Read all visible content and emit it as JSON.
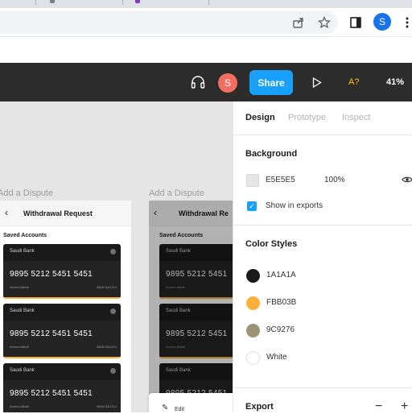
{
  "browser": {
    "profile_initial": "S"
  },
  "toolbar": {
    "avatar_initial": "S",
    "share_label": "Share",
    "accessibility_label": "A?",
    "zoom": "41%"
  },
  "canvas": {
    "frames": [
      {
        "label": "Add a Dispute",
        "title": "Withdrawal Request",
        "saved_label": "Saved Accounts",
        "cards": [
          {
            "bank": "Saudi Bank",
            "number": "9895  5212  5451  5451",
            "holder": "Ahmed Alttafi",
            "iban": "IBAN SA1214"
          },
          {
            "bank": "Saudi Bank",
            "number": "9895  5212  5451  5451",
            "holder": "Ahmed Alttafi",
            "iban": "IBAN SA1214"
          },
          {
            "bank": "Saudi Bank",
            "number": "9895  5212  5451  5451",
            "holder": "Ahmed Alttafi",
            "iban": "IBAN SA1214"
          }
        ]
      },
      {
        "label": "Add a Dispute",
        "title": "Withdrawal Re",
        "saved_label": "Saved Accounts",
        "cards": [
          {
            "bank": "Saudi Bank",
            "number": "9895  5212  5451",
            "holder": "Ahmed Alttafi",
            "iban": ""
          },
          {
            "bank": "Saudi Bank",
            "number": "9895  5212  5451",
            "holder": "Ahmed Alttafi",
            "iban": ""
          },
          {
            "bank": "Saudi Bank",
            "number": "9895  5212  5451",
            "holder": "Ahmed Alttafi",
            "iban": ""
          }
        ]
      }
    ],
    "popup_label": "Edit"
  },
  "panel": {
    "tabs": [
      {
        "label": "Design"
      },
      {
        "label": "Prototype"
      },
      {
        "label": "Inspect"
      }
    ],
    "background": {
      "heading": "Background",
      "hex": "E5E5E5",
      "opacity": "100%",
      "show_exports": "Show in exports"
    },
    "color_styles": {
      "heading": "Color Styles",
      "items": [
        {
          "name": "1A1A1A",
          "color": "#1a1a1a"
        },
        {
          "name": "FBB03B",
          "color": "#fbb03b"
        },
        {
          "name": "9C9276",
          "color": "#9c9276"
        },
        {
          "name": "White",
          "color": "#ffffff"
        }
      ]
    },
    "export": {
      "heading": "Export",
      "minus": "−",
      "plus": "+"
    }
  },
  "colors": {
    "toolbar_bg": "#2c2c2c",
    "share_blue": "#18a0fb",
    "accent_orange": "#fbb03b",
    "canvas_bg": "#e5e5e5"
  }
}
